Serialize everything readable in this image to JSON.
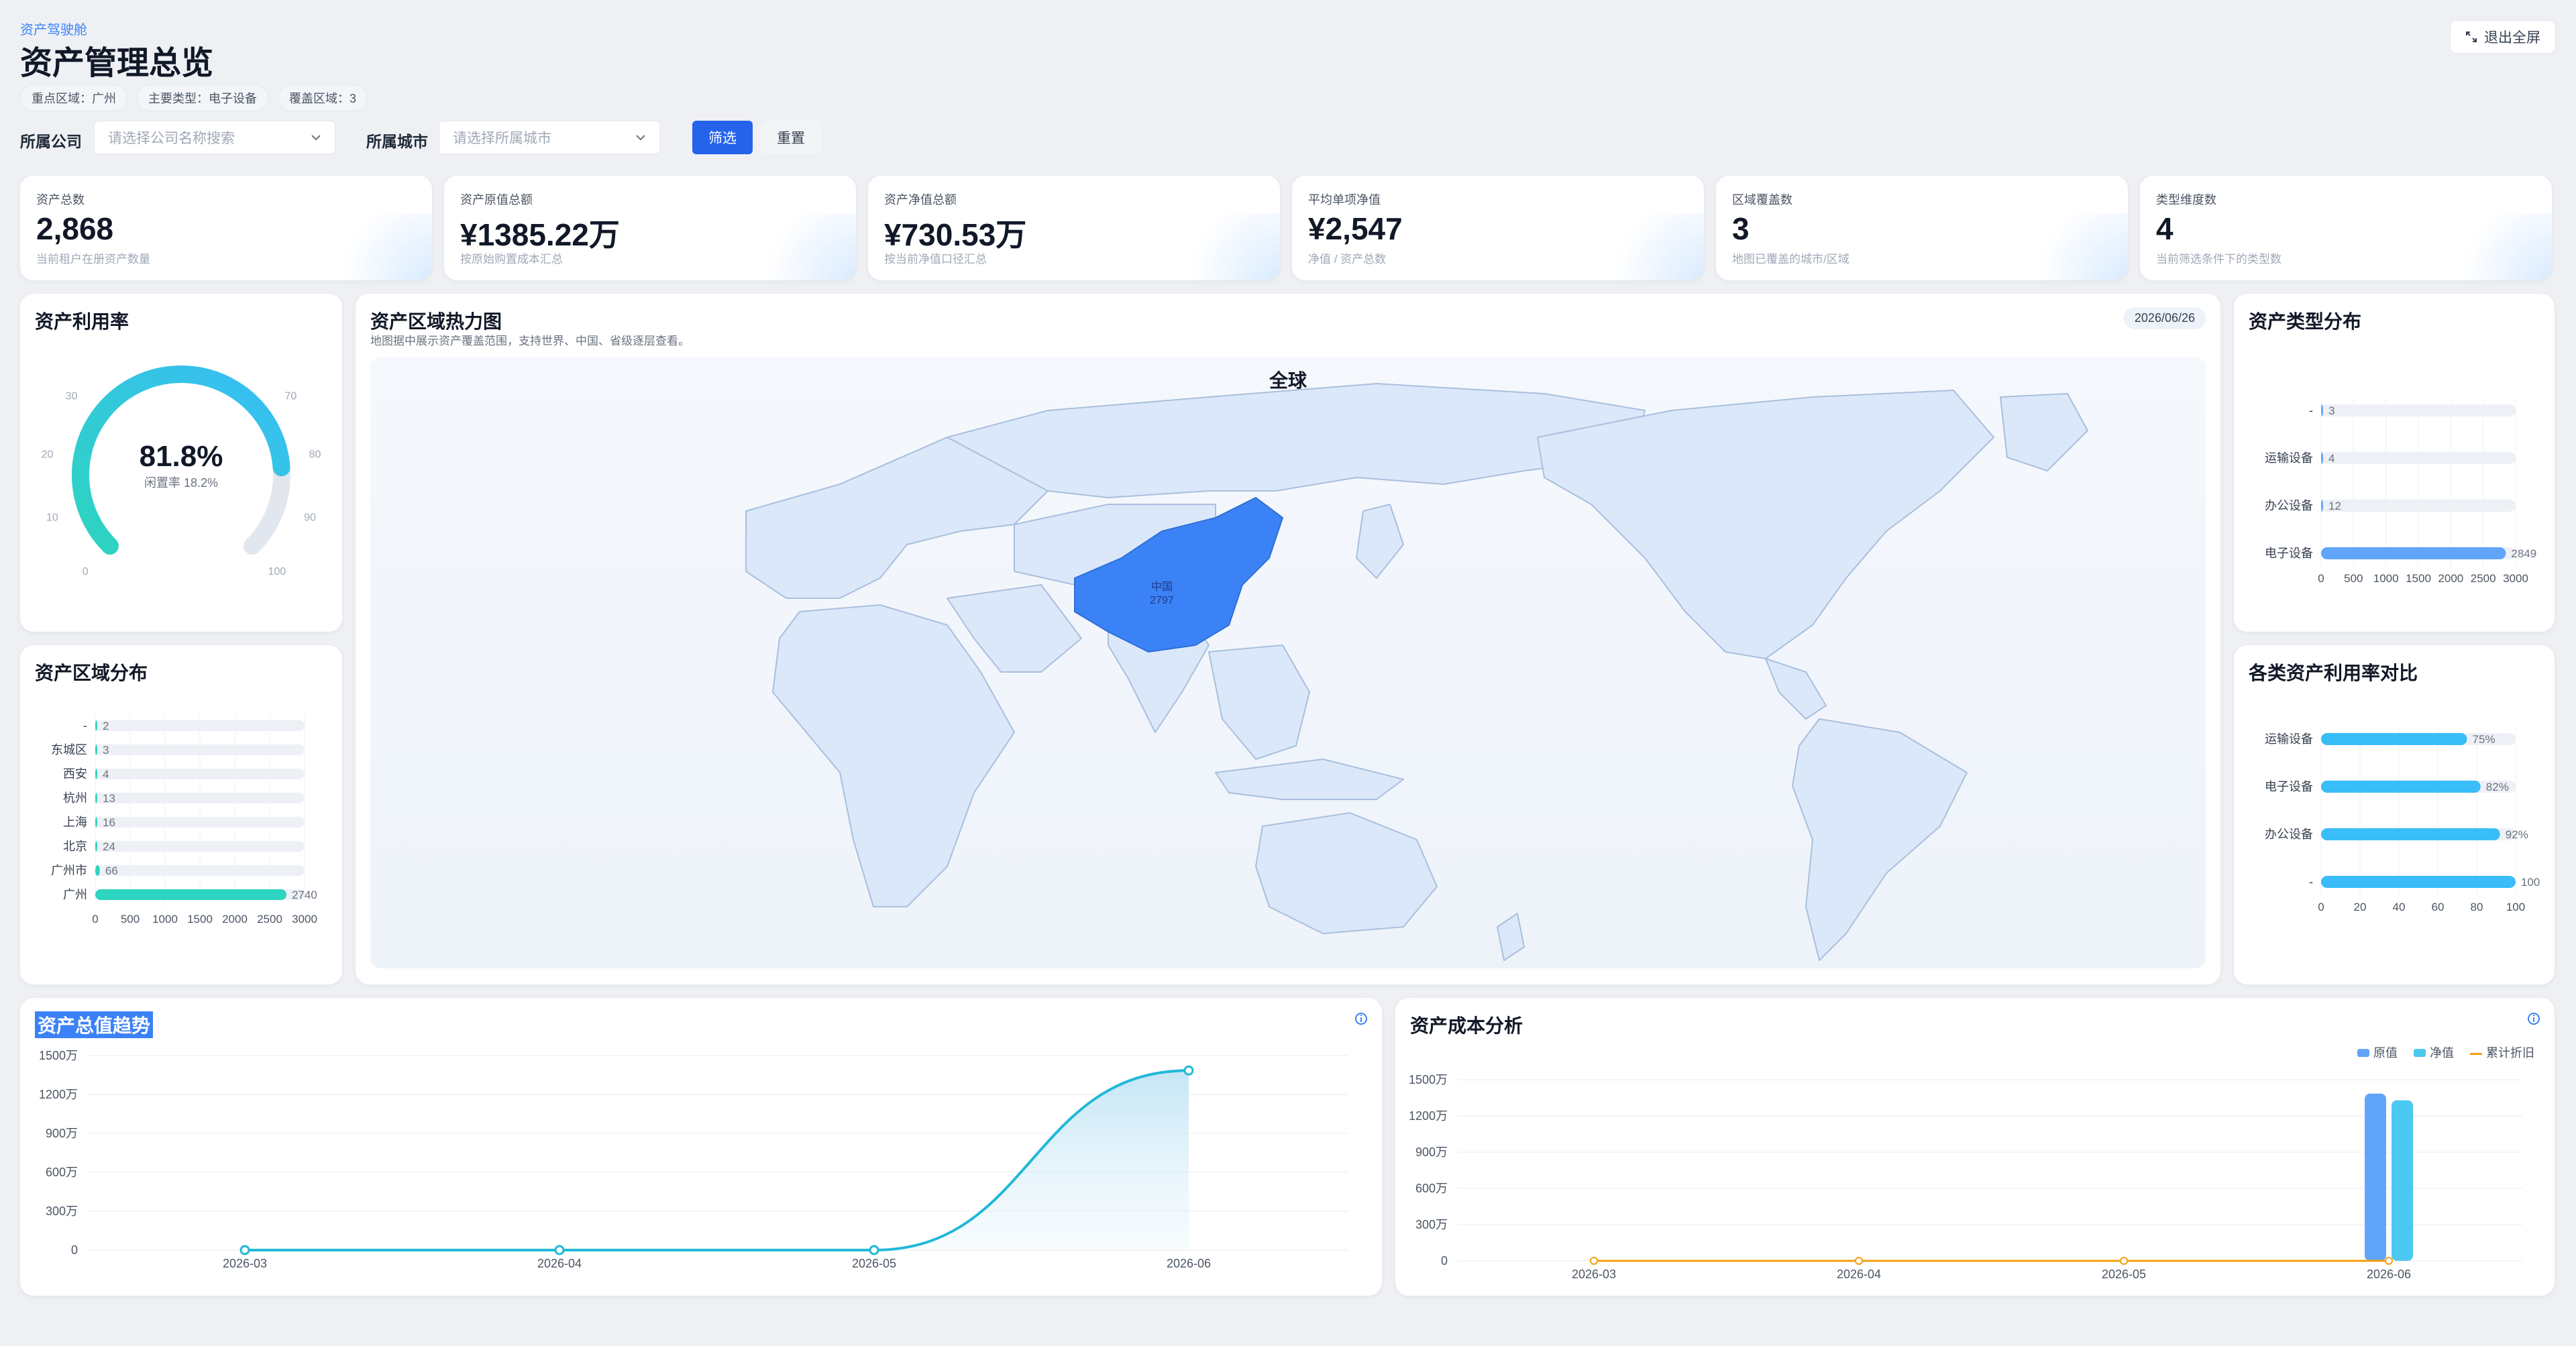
{
  "header": {
    "breadcrumb": "资产驾驶舱",
    "title": "资产管理总览",
    "tags": [
      "重点区域：广州",
      "主要类型：电子设备",
      "覆盖区域：3"
    ],
    "exit_fullscreen": "退出全屏"
  },
  "filters": {
    "company_label": "所属公司",
    "company_placeholder": "请选择公司名称搜索",
    "city_label": "所属城市",
    "city_placeholder": "请选择所属城市",
    "filter_button": "筛选",
    "reset_button": "重置"
  },
  "kpis": [
    {
      "label": "资产总数",
      "value": "2,868",
      "desc": "当前租户在册资产数量"
    },
    {
      "label": "资产原值总额",
      "value": "¥1385.22万",
      "desc": "按原始购置成本汇总"
    },
    {
      "label": "资产净值总额",
      "value": "¥730.53万",
      "desc": "按当前净值口径汇总"
    },
    {
      "label": "平均单项净值",
      "value": "¥2,547",
      "desc": "净值 / 资产总数"
    },
    {
      "label": "区域覆盖数",
      "value": "3",
      "desc": "地图已覆盖的城市/区域"
    },
    {
      "label": "类型维度数",
      "value": "4",
      "desc": "当前筛选条件下的类型数"
    }
  ],
  "utilization": {
    "title": "资产利用率",
    "value_text": "81.8%",
    "idle_text": "闲置率 18.2%",
    "value": 81.8,
    "ticks": [
      "0",
      "10",
      "20",
      "30",
      "70",
      "80",
      "90",
      "100"
    ],
    "color_start": "#2dd4bf",
    "color_end": "#38bdf8"
  },
  "heatmap": {
    "title": "资产区域热力图",
    "subtitle": "地图据中展示资产覆盖范围，支持世界、中国、省级逐层查看。",
    "date": "2026/06/26",
    "map_title": "全球",
    "highlight_name": "中国",
    "highlight_value": "2797",
    "highlight_color": "#3b82f6",
    "land_color": "#dbe8fa"
  },
  "type_distribution": {
    "title": "资产类型分布",
    "chart_data": {
      "type": "bar",
      "orientation": "horizontal",
      "categories": [
        "-",
        "运输设备",
        "办公设备",
        "电子设备"
      ],
      "values": [
        3,
        4,
        12,
        2849
      ],
      "xlim": [
        0,
        3000
      ],
      "xticks": [
        "0",
        "500",
        "1000",
        "1500",
        "2000",
        "2500",
        "3000"
      ],
      "color": "#60a5fa"
    }
  },
  "region_distribution": {
    "title": "资产区域分布",
    "chart_data": {
      "type": "bar",
      "orientation": "horizontal",
      "categories": [
        "-",
        "东城区",
        "西安",
        "杭州",
        "上海",
        "北京",
        "广州市",
        "广州"
      ],
      "values": [
        2,
        3,
        4,
        13,
        16,
        24,
        66,
        2740
      ],
      "xlim": [
        0,
        3000
      ],
      "xticks": [
        "0",
        "500",
        "1000",
        "1500",
        "2000",
        "2500",
        "3000"
      ],
      "color": "#2dd4bf"
    }
  },
  "utilization_compare": {
    "title": "各类资产利用率对比",
    "chart_data": {
      "type": "bar",
      "orientation": "horizontal",
      "categories": [
        "运输设备",
        "电子设备",
        "办公设备",
        "-"
      ],
      "values": [
        75,
        82,
        92,
        100
      ],
      "labels": [
        "75%",
        "82%",
        "92%",
        "100"
      ],
      "xlim": [
        0,
        100
      ],
      "xticks": [
        "0",
        "20",
        "40",
        "60",
        "80",
        "100"
      ],
      "color": "#38bdf8"
    }
  },
  "trend": {
    "title": "资产总值趋势",
    "chart_data": {
      "type": "area",
      "categories": [
        "2026-03",
        "2026-04",
        "2026-05",
        "2026-06"
      ],
      "values": [
        0,
        0,
        0,
        1385.22
      ],
      "unit": "万",
      "ylim": [
        0,
        1500
      ],
      "yticks": [
        "0",
        "300万",
        "600万",
        "900万",
        "1200万",
        "1500万"
      ],
      "color": "#22b8d8"
    }
  },
  "cost": {
    "title": "资产成本分析",
    "legend": [
      "原值",
      "净值",
      "累计折旧"
    ],
    "chart_data": {
      "type": "bar",
      "categories": [
        "2026-03",
        "2026-04",
        "2026-05",
        "2026-06"
      ],
      "series": [
        {
          "name": "原值",
          "values": [
            0,
            0,
            0,
            1385.22
          ],
          "color": "#60a5fa"
        },
        {
          "name": "净值",
          "values": [
            0,
            0,
            0,
            1330
          ],
          "color": "#4cc9f0"
        },
        {
          "name": "累计折旧",
          "values": [
            0,
            0,
            0,
            0
          ],
          "color": "#f59e0b"
        }
      ],
      "ylim": [
        0,
        1500
      ],
      "yticks": [
        "0",
        "300万",
        "600万",
        "900万",
        "1200万",
        "1500万"
      ]
    }
  }
}
